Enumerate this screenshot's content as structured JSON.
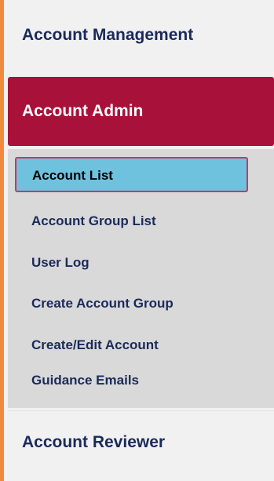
{
  "nav": {
    "sections": [
      {
        "label": "Account Management"
      },
      {
        "label": "Account Admin",
        "items": [
          {
            "label": "Account List",
            "active": true
          },
          {
            "label": "Account Group List"
          },
          {
            "label": "User Log"
          },
          {
            "label": "Create Account Group"
          },
          {
            "label": "Create/Edit Account"
          },
          {
            "label": "Guidance Emails"
          }
        ]
      },
      {
        "label": "Account Reviewer"
      }
    ]
  },
  "colors": {
    "accent_bar": "#ef8a3c",
    "active_section_bg": "#a8113a",
    "active_item_bg": "#6ec2de",
    "active_item_border": "#d0336a",
    "text": "#1b2a5b"
  }
}
